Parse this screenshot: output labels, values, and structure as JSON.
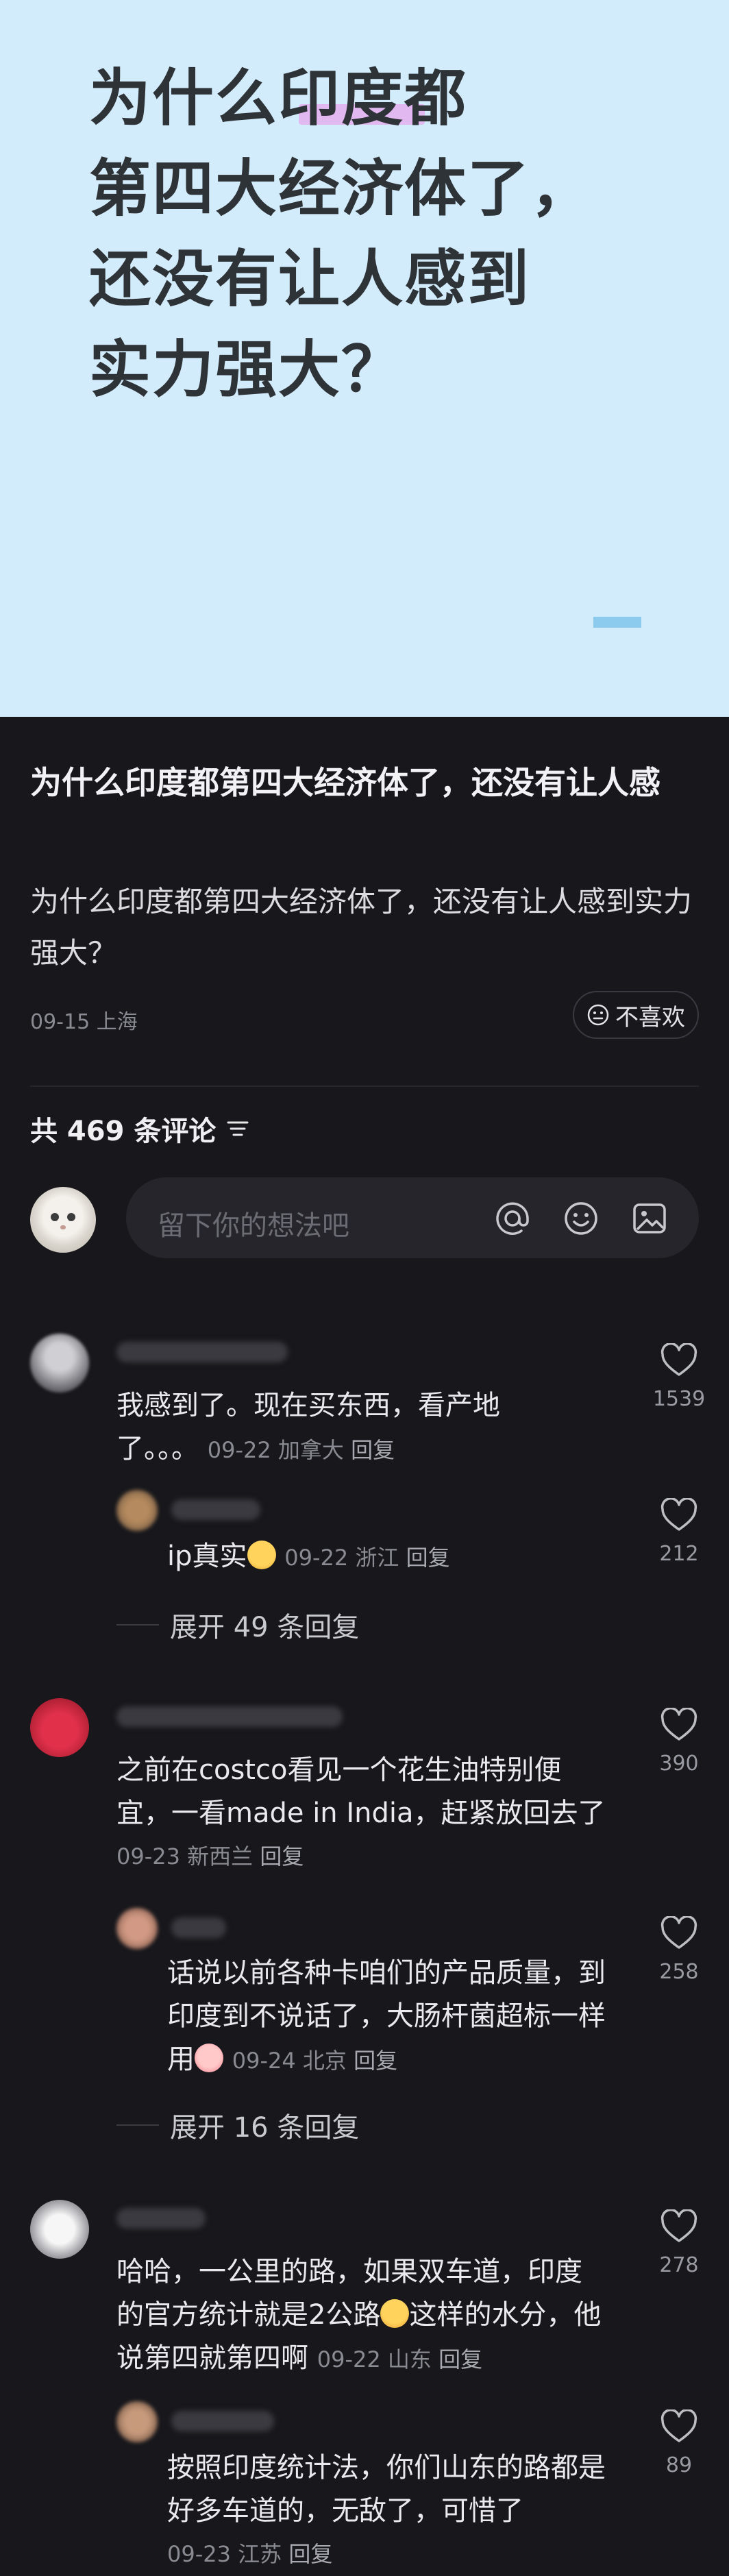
{
  "cover": {
    "title_lines": [
      "为什么印度都",
      "第四大经济体了，",
      "还没有让人感到",
      "实力强大？"
    ]
  },
  "post": {
    "title": "为什么印度都第四大经济体了，还没有让人感",
    "body": "为什么印度都第四大经济体了，还没有让人感到实力强大？",
    "date": "09-15",
    "location": "上海",
    "dislike_label": "不喜欢"
  },
  "comments_header": {
    "count_label": "共 469 条评论",
    "sort_icon": "sort-icon"
  },
  "composer": {
    "placeholder": "留下你的想法吧",
    "icons": [
      "at-icon",
      "emoji-icon",
      "image-icon"
    ]
  },
  "comments": [
    {
      "text": "我感到了。现在买东西，看产地了。。。",
      "line1": "我感到了。现在买东西，看产地",
      "line2": "了。。。",
      "date": "09-22",
      "location": "加拿大",
      "reply_label": "回复",
      "likes": "1539",
      "replies": [
        {
          "text": "ip真实",
          "emoji": "smirk-emoji",
          "date": "09-22",
          "location": "浙江",
          "reply_label": "回复",
          "likes": "212"
        }
      ],
      "expand_label": "展开 49 条回复"
    },
    {
      "line1": "之前在costco看见一个花生油特别便",
      "line2": "宜，一看made in India，赶紧放回去了",
      "date": "09-23",
      "location": "新西兰",
      "reply_label": "回复",
      "likes": "390",
      "replies": [
        {
          "line1": "话说以前各种卡咱们的产品质量，到",
          "line2": "印度到不说话了，大肠杆菌超标一样",
          "line3": "用",
          "emoji": "peach-emoji",
          "date": "09-24",
          "location": "北京",
          "reply_label": "回复",
          "likes": "258"
        }
      ],
      "expand_label": "展开 16 条回复"
    },
    {
      "line1": "哈哈，一公里的路，如果双车道，印度",
      "line2a": "的官方统计就是2公路",
      "line2b": "这样的水分，他",
      "line3": "说第四就第四啊",
      "emoji": "crying-emoji",
      "date": "09-22",
      "location": "山东",
      "reply_label": "回复",
      "likes": "278",
      "replies": [
        {
          "line1": "按照印度统计法，你们山东的路都是",
          "line2": "好多车道的，无敌了，可惜了",
          "date": "09-23",
          "location": "江苏",
          "reply_label": "回复",
          "likes": "89"
        }
      ]
    }
  ],
  "colors": {
    "cover_bg": "#d3ecfb",
    "page_bg": "#17171c",
    "highlight": "#e7a7ec",
    "accent_dash": "#8dcbee"
  }
}
